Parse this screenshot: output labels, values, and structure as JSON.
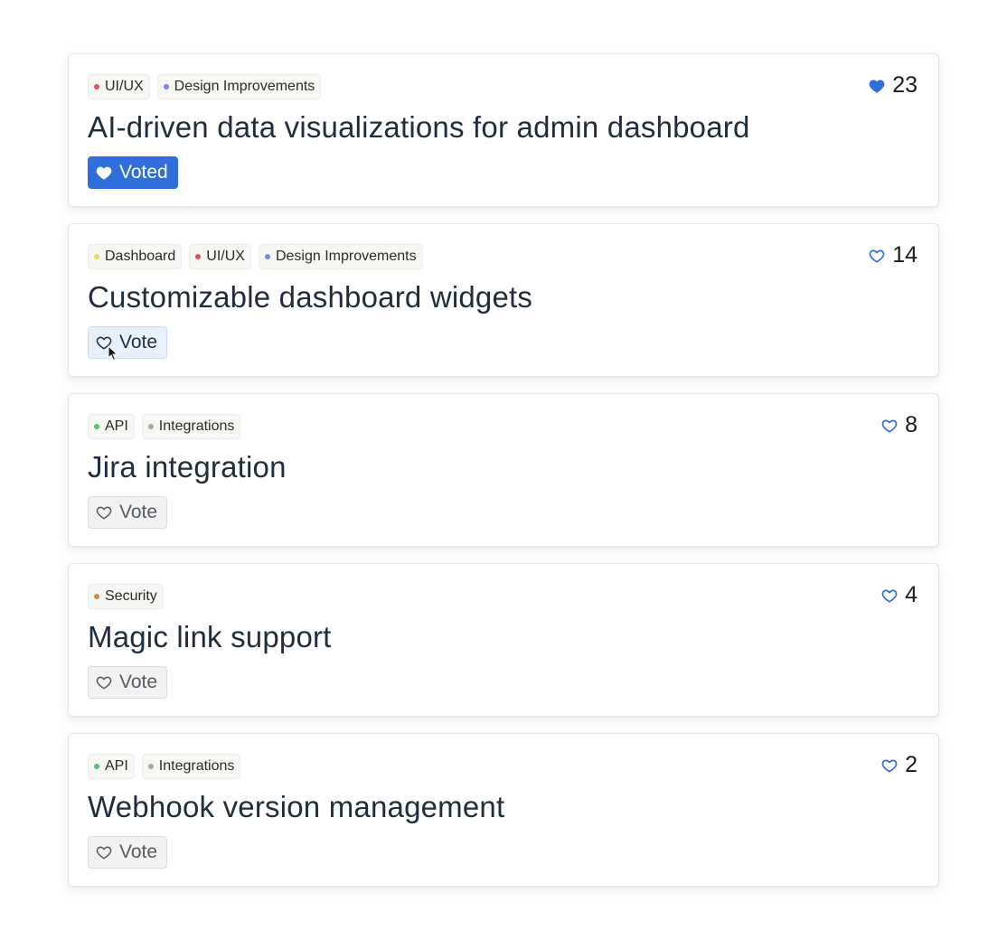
{
  "colors": {
    "accent": "#2f6fdc",
    "title": "#1f2d3d"
  },
  "icons": {
    "count": "heart-icon",
    "vote": "heart-icon"
  },
  "ideas": [
    {
      "tags": [
        {
          "label": "UI/UX",
          "color": "#e05252"
        },
        {
          "label": "Design Improvements",
          "color": "#7b86f0"
        }
      ],
      "count": "23",
      "title": "AI-driven data visualizations for admin dashboard",
      "vote_label": "Voted",
      "state": "voted"
    },
    {
      "tags": [
        {
          "label": "Dashboard",
          "color": "#f4d35e"
        },
        {
          "label": "UI/UX",
          "color": "#e05252"
        },
        {
          "label": "Design Improvements",
          "color": "#7b86f0"
        }
      ],
      "count": "14",
      "title": "Customizable dashboard widgets",
      "vote_label": "Vote",
      "state": "hover"
    },
    {
      "tags": [
        {
          "label": "API",
          "color": "#4cc46a"
        },
        {
          "label": "Integrations",
          "color": "#a8a8a8"
        }
      ],
      "count": "8",
      "title": "Jira integration",
      "vote_label": "Vote",
      "state": "default"
    },
    {
      "tags": [
        {
          "label": "Security",
          "color": "#c9874a"
        }
      ],
      "count": "4",
      "title": "Magic link support",
      "vote_label": "Vote",
      "state": "default"
    },
    {
      "tags": [
        {
          "label": "API",
          "color": "#4cc46a"
        },
        {
          "label": "Integrations",
          "color": "#a8a8a8"
        }
      ],
      "count": "2",
      "title": "Webhook version management",
      "vote_label": "Vote",
      "state": "default"
    }
  ]
}
